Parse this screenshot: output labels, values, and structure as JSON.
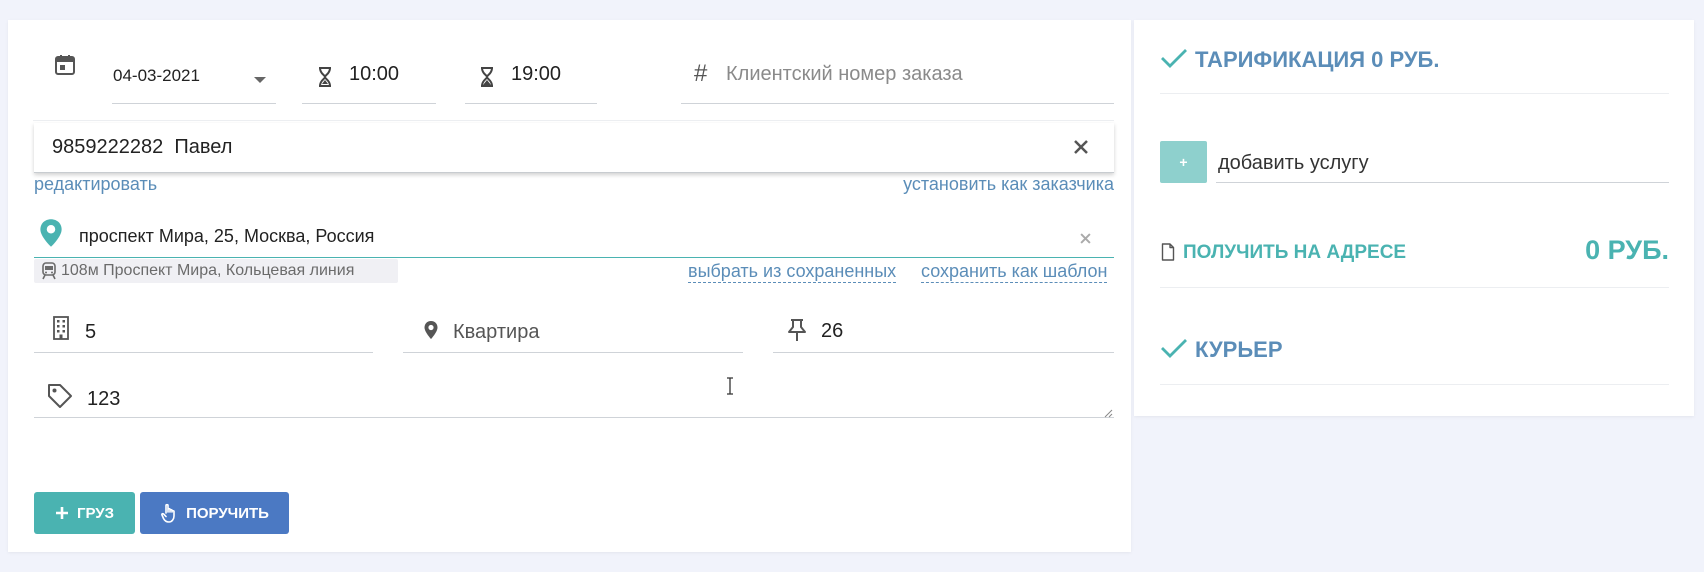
{
  "order": {
    "date": "04-03-2021",
    "time_from": "10:00",
    "time_to": "19:00",
    "client_number_placeholder": "Клиентский номер заказа"
  },
  "contact": {
    "value": "9859222282  Павел",
    "edit_link": "редактировать",
    "set_customer_link": "установить как заказчика"
  },
  "address": {
    "value": "проспект Мира, 25, Москва, Россия",
    "metro": "108м Проспект Мира, Кольцевая линия",
    "choose_saved": "выбрать из сохраненных",
    "save_template": "сохранить как шаблон",
    "building": "5",
    "apartment_placeholder": "Квартира",
    "floor": "26"
  },
  "comment": {
    "value": "123"
  },
  "buttons": {
    "cargo": "ГРУЗ",
    "receive": "ПОРУЧИТЬ"
  },
  "sidebar": {
    "tarification": "ТАРИФИКАЦИЯ 0 РУБ.",
    "add_service_plus": "+",
    "add_service": "добавить услугу",
    "receive_at_address": "ПОЛУЧИТЬ НА АДРЕСЕ",
    "receive_amount": "0 РУБ.",
    "courier": "КУРЬЕР"
  },
  "colors": {
    "accent_teal": "#4ab3b1",
    "link_blue": "#5b8db8",
    "button_blue": "#4b79c3",
    "plus_button": "#8ed0cd"
  }
}
